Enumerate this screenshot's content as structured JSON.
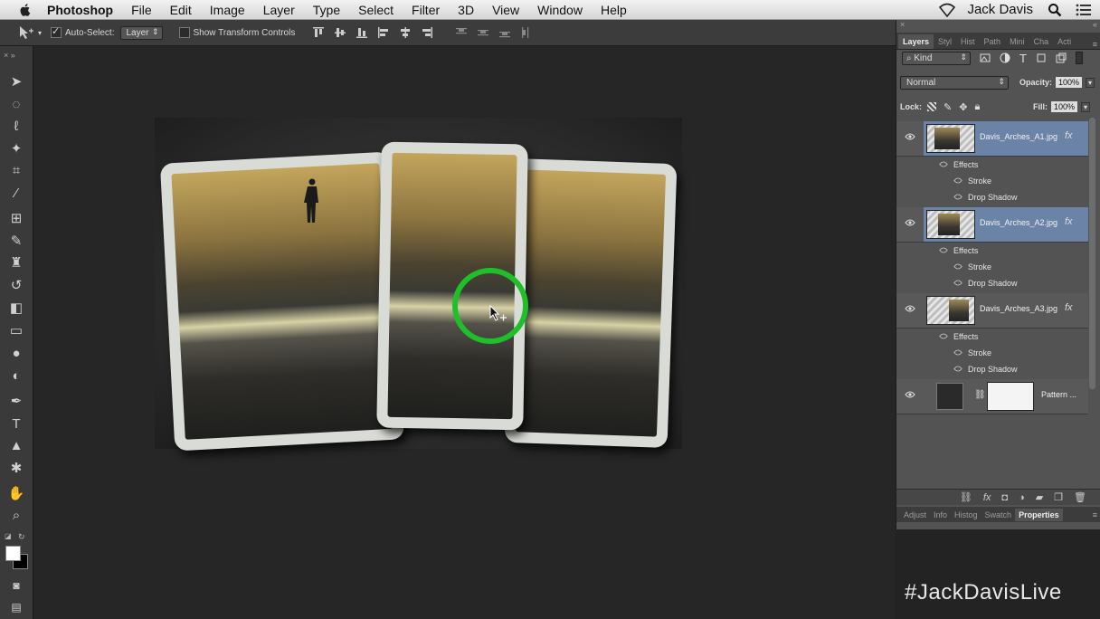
{
  "menubar": {
    "app_name": "Photoshop",
    "items": [
      "File",
      "Edit",
      "Image",
      "Layer",
      "Type",
      "Select",
      "Filter",
      "3D",
      "View",
      "Window",
      "Help"
    ],
    "user": "Jack Davis"
  },
  "options_bar": {
    "auto_select_label": "Auto-Select:",
    "auto_select_checked": true,
    "auto_select_value": "Layer",
    "show_transform_label": "Show Transform Controls"
  },
  "panel": {
    "tabs": [
      "Layers",
      "Styl",
      "Hist",
      "Path",
      "Mini",
      "Cha",
      "Acti"
    ],
    "kind_label": "Kind",
    "blend_mode": "Normal",
    "opacity_label": "Opacity:",
    "opacity_value": "100%",
    "lock_label": "Lock:",
    "fill_label": "Fill:",
    "fill_value": "100%",
    "layers": [
      {
        "name": "Davis_Arches_A1.jpg",
        "fx": "fx",
        "effects_label": "Effects",
        "effects": [
          "Stroke",
          "Drop Shadow"
        ],
        "selected": true
      },
      {
        "name": "Davis_Arches_A2.jpg",
        "fx": "fx",
        "effects_label": "Effects",
        "effects": [
          "Stroke",
          "Drop Shadow"
        ],
        "selected": true
      },
      {
        "name": "Davis_Arches_A3.jpg",
        "fx": "fx",
        "effects_label": "Effects",
        "effects": [
          "Stroke",
          "Drop Shadow"
        ],
        "selected": false
      },
      {
        "name": "Pattern ..."
      }
    ],
    "bottom_tabs": [
      "Adjust",
      "Info",
      "Histog",
      "Swatch",
      "Properties"
    ]
  },
  "watermark": "#JackDavisLive",
  "colors": {
    "selection": "#6c83a8",
    "cursor_ring": "#1fbf2a",
    "panel_bg": "#535353"
  }
}
